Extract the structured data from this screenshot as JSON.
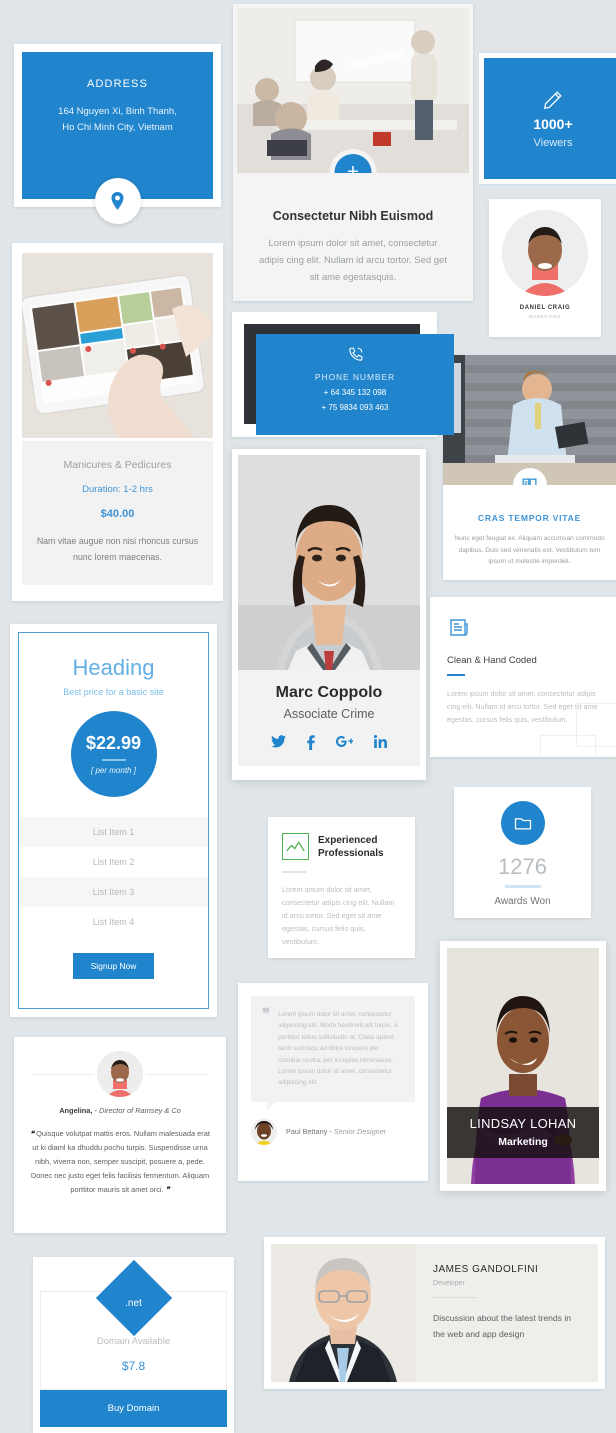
{
  "address": {
    "title": "ADDRESS",
    "line1": "164 Nguyen Xi, Binh Thanh,",
    "line2": "Ho Chi Minh City, Vietnam",
    "icon": "map-pin-icon"
  },
  "meeting": {
    "title": "Consectetur Nibh Euismod",
    "body": "Lorem ipsum dolor sit amet, consectetur adipis cing elit. Nullam id arcu tortor. Sed get sit ame egestasquis.",
    "plus_label": "+"
  },
  "viewers": {
    "count": "1000+",
    "label": "Viewers",
    "icon": "pencil-icon"
  },
  "daniel": {
    "name": "DANIEL CRAIG",
    "role": "MARKETING"
  },
  "cras": {
    "title": "CRAS TEMPOR VITAE",
    "body": "Nunc eget feugiat ex. Aliquam accumsan commodo dapibus. Duis sed venenatis est. Vestibulum tem ipsum ut molestie imperdiet.",
    "icon": "book-icon"
  },
  "clean": {
    "title": "Clean & Hand Coded",
    "body": "Lorem ipsum dolor sit amet, consectetur adipis cing elit. Nullam id arcu tortor. Sed eget sit ame egestas, cursus felis quis, vestibulum.",
    "icon": "newspaper-icon"
  },
  "awards": {
    "count": "1276",
    "label": "Awards Won",
    "icon": "folder-icon"
  },
  "manicure": {
    "title": "Manicures & Pedicures",
    "duration": "Duration: 1-2 hrs",
    "price": "$40.00",
    "body": "Nam vitae augue non nisi rhoncus cursus nunc lorem maecenas."
  },
  "phone": {
    "label": "PHONE NUMBER",
    "number1": "+ 64 345 132 098",
    "number2": "+ 75 9834 093 463",
    "icon": "phone-icon"
  },
  "marc": {
    "name": "Marc Coppolo",
    "role": "Associate Crime",
    "social": [
      "twitter-icon",
      "facebook-icon",
      "google-plus-icon",
      "linkedin-icon"
    ]
  },
  "pricing": {
    "heading": "Heading",
    "subheading": "Best price for a basic site",
    "amount": "$22.99",
    "period": "[ per month ]",
    "items": [
      "List Item 1",
      "List Item 2",
      "List Item 3",
      "List Item 4"
    ],
    "cta": "Signup Now"
  },
  "experienced": {
    "title_line1": "Experienced",
    "title_line2": "Professionals",
    "body": "Lorem ipsum dolor sit amet, consectetur adipis cing elit. Nullam id arcu tortor. Sed eget sit ame egestas, cursus felis quis, vestibulum.",
    "icon": "chart-line-icon"
  },
  "paul": {
    "quote_mark": "❞",
    "body": "Lorem ipsum dolor sit amet, consectetur adipiscing elit. Morbi hendrerit elit turpis, a porttitor tellus sollicitudin at. Class aptent taciti sociosqu ad litora torquent per conubia nostra, per inceptos himenaeos. Lorem ipsum dolor sit amet, consectetur adipiscing elit.",
    "name": "Paul Bettany",
    "role": "Senior Designer",
    "separator": " - "
  },
  "angelina": {
    "name": "Angelina,",
    "separator": " - ",
    "role": "Director of Ramsey & Co",
    "open_mark": "❝",
    "close_mark": "❞",
    "body": "Quisque volutpat mattis eros. Nullam malesuada erat ut ki diaml ka dhuddu pochu turpis. Suspendisse urna nibh, viverra non, semper suscipit, posuere a, pede. Donec nec justo eget felis facilisis fermentum. Aliquam porttitor mauris sit amet orci."
  },
  "lindsay": {
    "name": "LINDSAY LOHAN",
    "role": "Marketing"
  },
  "james": {
    "name": "JAMES GANDOLFINI",
    "role": "Developer",
    "body": "Discussion about the latest trends in the web and app design"
  },
  "domain": {
    "tld": ".net",
    "status": "Domain Available",
    "price": "$7.8",
    "cta": "Buy Domain"
  },
  "colors": {
    "accent_blue": "#2185cd",
    "page_bg": "#dfe5e8",
    "panel_grey": "#f2f2f2",
    "green": "#4caf50",
    "dark": "#2f3338"
  }
}
